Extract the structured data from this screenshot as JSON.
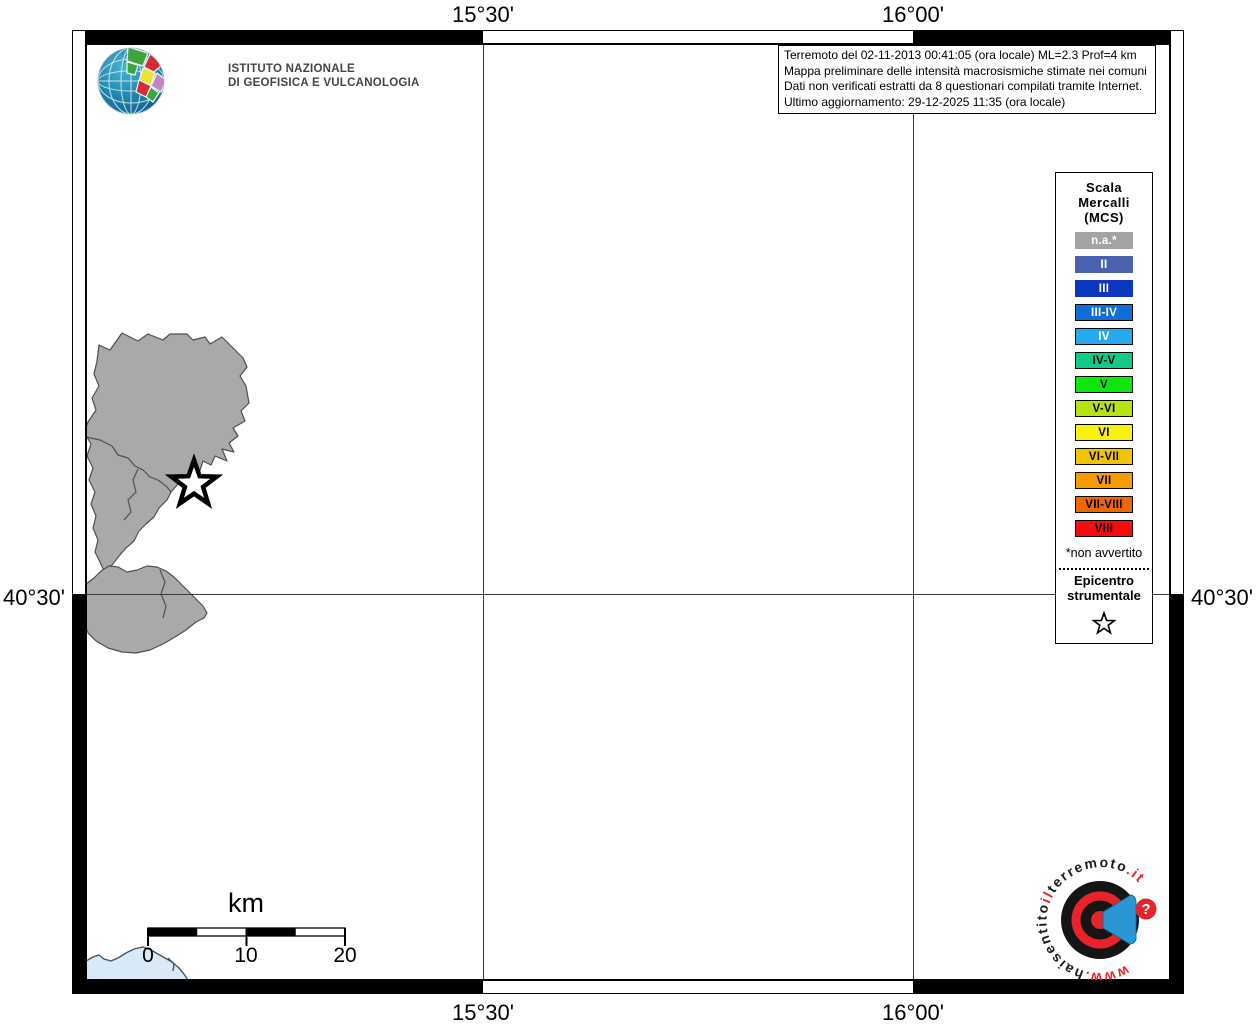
{
  "branding": {
    "institute_line1": "ISTITUTO NAZIONALE",
    "institute_line2": "DI GEOFISICA E VULCANOLOGIA"
  },
  "info_box": {
    "line1": "Terremoto del 02-11-2013 00:41:05 (ora locale) ML=2.3 Prof=4 km",
    "line2": "Mappa preliminare delle intensità macrosismiche stimate nei comuni",
    "line3": "Dati non verificati estratti da 8 questionari compilati tramite Internet.",
    "line4": "Ultimo aggiornamento: 29-12-2025 11:35 (ora locale)"
  },
  "axis": {
    "top_left": "15°30'",
    "top_right": "16°00'",
    "bottom_left": "15°30'",
    "bottom_right": "16°00'",
    "left": "40°30'",
    "right": "40°30'"
  },
  "legend": {
    "title_line1": "Scala",
    "title_line2": "Mercalli",
    "title_line3": "(MCS)",
    "items": [
      {
        "label": "n.a.*",
        "color": "#a3a3a3",
        "border": "#a3a3a3",
        "text": "#ffffff"
      },
      {
        "label": "II",
        "color": "#4b63ae",
        "border": "#4b63ae",
        "text": "#ffffff"
      },
      {
        "label": "III",
        "color": "#0c38c0",
        "border": "#0c38c0",
        "text": "#ffffff"
      },
      {
        "label": "III-IV",
        "color": "#0e6fd8",
        "border": "#000000",
        "text": "#ffffff"
      },
      {
        "label": "IV",
        "color": "#27a9ee",
        "border": "#000000",
        "text": "#ffffff"
      },
      {
        "label": "IV-V",
        "color": "#10ca87",
        "border": "#000000",
        "text": "#000000"
      },
      {
        "label": "V",
        "color": "#0ee60e",
        "border": "#000000",
        "text": "#000000"
      },
      {
        "label": "V-VI",
        "color": "#b6e112",
        "border": "#000000",
        "text": "#000000"
      },
      {
        "label": "VI",
        "color": "#f8f00f",
        "border": "#000000",
        "text": "#000000"
      },
      {
        "label": "VI-VII",
        "color": "#f2c302",
        "border": "#000000",
        "text": "#000000"
      },
      {
        "label": "VII",
        "color": "#f79c00",
        "border": "#000000",
        "text": "#000000"
      },
      {
        "label": "VII-VIII",
        "color": "#ee6702",
        "border": "#000000",
        "text": "#000000"
      },
      {
        "label": "VIII",
        "color": "#f50c0c",
        "border": "#000000",
        "text": "#000000"
      }
    ],
    "footnote": "*non avvertito",
    "epicenter_line1": "Epicentro",
    "epicenter_line2": "strumentale"
  },
  "scale_bar": {
    "unit": "km",
    "tick0": "0",
    "tick1": "10",
    "tick2": "20"
  },
  "watermark": {
    "part_www": {
      "text": "www.",
      "color": "#e8232a"
    },
    "part_hai": {
      "text": "haisentito",
      "color": "#1c1c1c"
    },
    "part_il": {
      "text": "il",
      "color": "#e8232a"
    },
    "part_terremoto": {
      "text": "terremoto",
      "color": "#1c1c1c"
    },
    "part_it": {
      "text": ".it",
      "color": "#e8232a"
    },
    "question_mark": "?"
  }
}
